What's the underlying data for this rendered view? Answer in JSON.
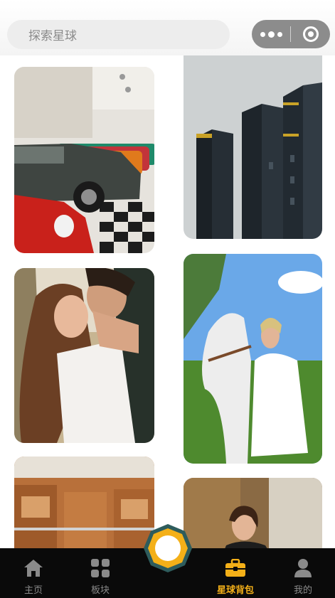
{
  "search": {
    "placeholder": "探索星球"
  },
  "capsule": {
    "more_icon": "more-dots-icon",
    "close_icon": "target-circle-icon"
  },
  "feed": {
    "cards": [
      {
        "name": "vintage-cars-photo",
        "subject": "classic cars in showroom"
      },
      {
        "name": "dark-building-photo",
        "subject": "dark tower block"
      },
      {
        "name": "couple-photo",
        "subject": "couple embracing"
      },
      {
        "name": "horse-woman-photo",
        "subject": "woman with white horse"
      },
      {
        "name": "interior-photo",
        "subject": "wooden interior"
      },
      {
        "name": "woman-portrait-photo",
        "subject": "woman portrait"
      }
    ]
  },
  "tabbar": {
    "tabs": [
      {
        "label": "主页",
        "icon": "home-icon"
      },
      {
        "label": "板块",
        "icon": "grid-icon"
      },
      {
        "label": "星球背包",
        "icon": "briefcase-icon",
        "active": true
      },
      {
        "label": "我的",
        "icon": "user-icon"
      }
    ],
    "center_icon": "octagon-ring-icon"
  },
  "colors": {
    "accent": "#f4b018",
    "tabbar_bg": "#0a0a0a",
    "center_ring": "#2e5c5c"
  }
}
